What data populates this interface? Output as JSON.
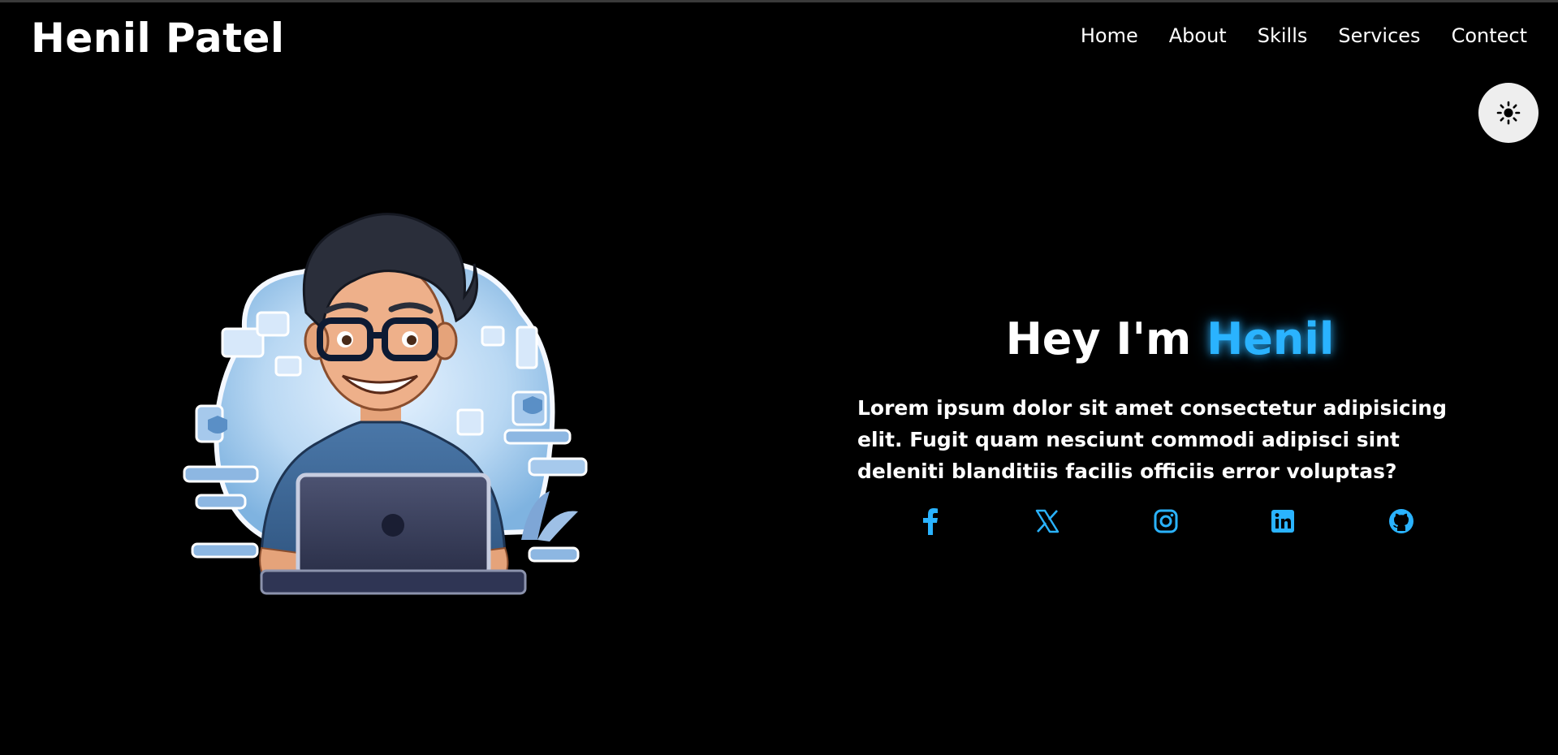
{
  "header": {
    "brand": "Henil Patel",
    "nav": [
      "Home",
      "About",
      "Skills",
      "Services",
      "Contect"
    ]
  },
  "theme_toggle": {
    "icon": "sun-icon"
  },
  "hero": {
    "title_prefix": "Hey I'm ",
    "title_name": "Henil",
    "description": "Lorem ipsum dolor sit amet consectetur adipisicing elit. Fugit quam nesciunt commodi adipisci sint deleniti blanditiis facilis officiis error voluptas?",
    "avatar": "developer-illustration"
  },
  "socials": [
    "facebook-icon",
    "x-twitter-icon",
    "instagram-icon",
    "linkedin-icon",
    "github-icon"
  ],
  "colors": {
    "background": "#000000",
    "accent": "#2ab3ff",
    "text": "#ffffff"
  }
}
